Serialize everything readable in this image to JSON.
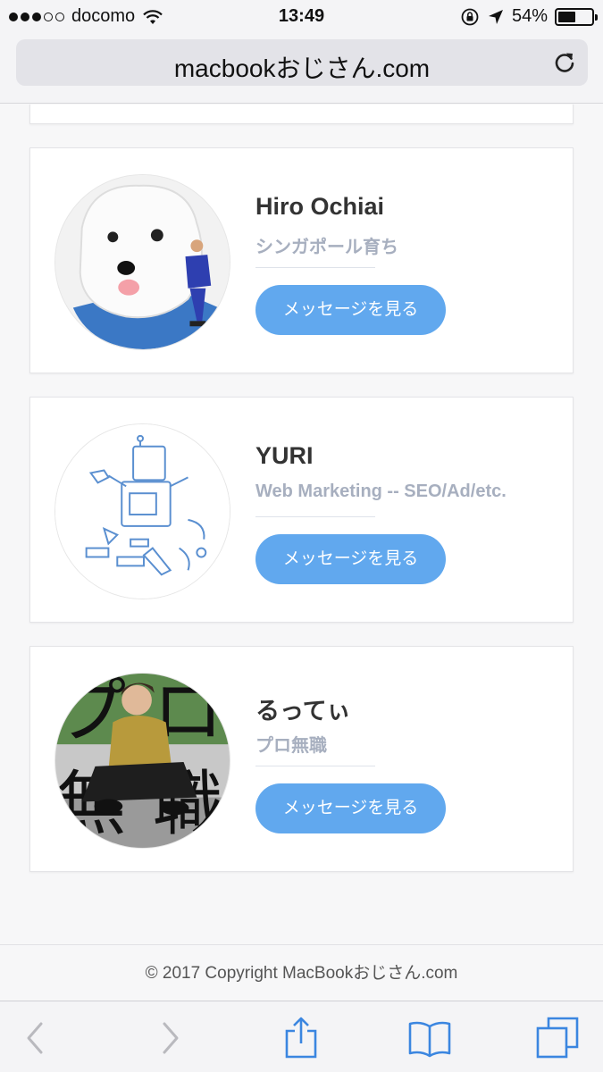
{
  "status_bar": {
    "carrier": "docomo",
    "time": "13:49",
    "battery_percent": "54%",
    "battery_level": 0.54,
    "signal_bars_filled": 3,
    "signal_bars_total": 5
  },
  "browser": {
    "address": "macbookおじさん.com"
  },
  "cards": [
    {
      "name": "Hiro Ochiai",
      "subtitle": "シンガポール育ち",
      "button_label": "メッセージを見る",
      "avatar": "dog-and-soccer-player-photo"
    },
    {
      "name": "YURI",
      "subtitle": "Web Marketing -- SEO/Ad/etc.",
      "button_label": "メッセージを見る",
      "avatar": "robot-sketch-illustration"
    },
    {
      "name": "るってぃ",
      "subtitle": "プロ無職",
      "button_label": "メッセージを見る",
      "avatar": "man-sitting-photo"
    }
  ],
  "footer": {
    "copyright": "© 2017 Copyright MacBookおじさん.com"
  },
  "toolbar": {
    "icons": [
      "back-icon",
      "forward-icon",
      "share-icon",
      "bookmarks-icon",
      "tabs-icon"
    ]
  },
  "colors": {
    "accent": "#61a8ee",
    "subtitle": "#a7afbf",
    "name": "#333333"
  }
}
